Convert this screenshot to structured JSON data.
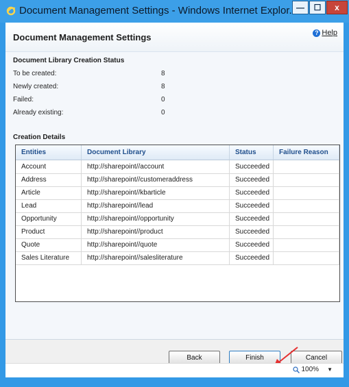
{
  "window": {
    "title": "Document Management Settings - Windows Internet Explor...",
    "controls": {
      "minimize": "—",
      "maximize": "☐",
      "close": "x"
    }
  },
  "header": {
    "title": "Document Management Settings",
    "help_label": "Help",
    "help_glyph": "?"
  },
  "creation_status": {
    "heading": "Document Library Creation Status",
    "rows": [
      {
        "label": "To be created:",
        "value": "8"
      },
      {
        "label": "Newly created:",
        "value": "8"
      },
      {
        "label": "Failed:",
        "value": "0"
      },
      {
        "label": "Already existing:",
        "value": "0"
      }
    ]
  },
  "details": {
    "heading": "Creation Details",
    "columns": [
      "Entities",
      "Document Library",
      "Status",
      "Failure Reason"
    ],
    "rows": [
      {
        "entity": "Account",
        "library": "http://sharepoint//account",
        "status": "Succeeded",
        "reason": ""
      },
      {
        "entity": "Address",
        "library": "http://sharepoint//customeraddress",
        "status": "Succeeded",
        "reason": ""
      },
      {
        "entity": "Article",
        "library": "http://sharepoint//kbarticle",
        "status": "Succeeded",
        "reason": ""
      },
      {
        "entity": "Lead",
        "library": "http://sharepoint//lead",
        "status": "Succeeded",
        "reason": ""
      },
      {
        "entity": "Opportunity",
        "library": "http://sharepoint//opportunity",
        "status": "Succeeded",
        "reason": ""
      },
      {
        "entity": "Product",
        "library": "http://sharepoint//product",
        "status": "Succeeded",
        "reason": ""
      },
      {
        "entity": "Quote",
        "library": "http://sharepoint//quote",
        "status": "Succeeded",
        "reason": ""
      },
      {
        "entity": "Sales Literature",
        "library": "http://sharepoint//salesliterature",
        "status": "Succeeded",
        "reason": ""
      }
    ]
  },
  "buttons": {
    "back": "Back",
    "finish": "Finish",
    "cancel": "Cancel"
  },
  "statusbar": {
    "zoom": "100%",
    "dropdown_glyph": "▼"
  },
  "colors": {
    "titlebar": "#3c9fe8",
    "header_text": "#1f4e8c",
    "annotation_arrow": "#e53030",
    "close_button": "#c7453a"
  }
}
